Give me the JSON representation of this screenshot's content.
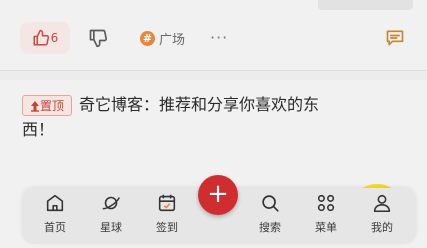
{
  "feed": {
    "card1": {
      "like_count": "6",
      "topic_badge": "#",
      "topic_label": "广场",
      "more": "···"
    },
    "card2": {
      "pin_label": "置顶",
      "title": "奇它博客：推荐和分享你喜欢的东西！"
    }
  },
  "bottom_nav": {
    "items": [
      {
        "label": "首页",
        "icon": "home-icon"
      },
      {
        "label": "星球",
        "icon": "planet-icon"
      },
      {
        "label": "签到",
        "icon": "calendar-icon"
      },
      {
        "label": "搜索",
        "icon": "search-icon"
      },
      {
        "label": "菜单",
        "icon": "menu-grid-icon"
      },
      {
        "label": "我的",
        "icon": "user-icon"
      }
    ],
    "fab_label": "+"
  },
  "colors": {
    "accent": "#cf2d2f",
    "topic": "#e8873a",
    "like": "#c94a41"
  }
}
